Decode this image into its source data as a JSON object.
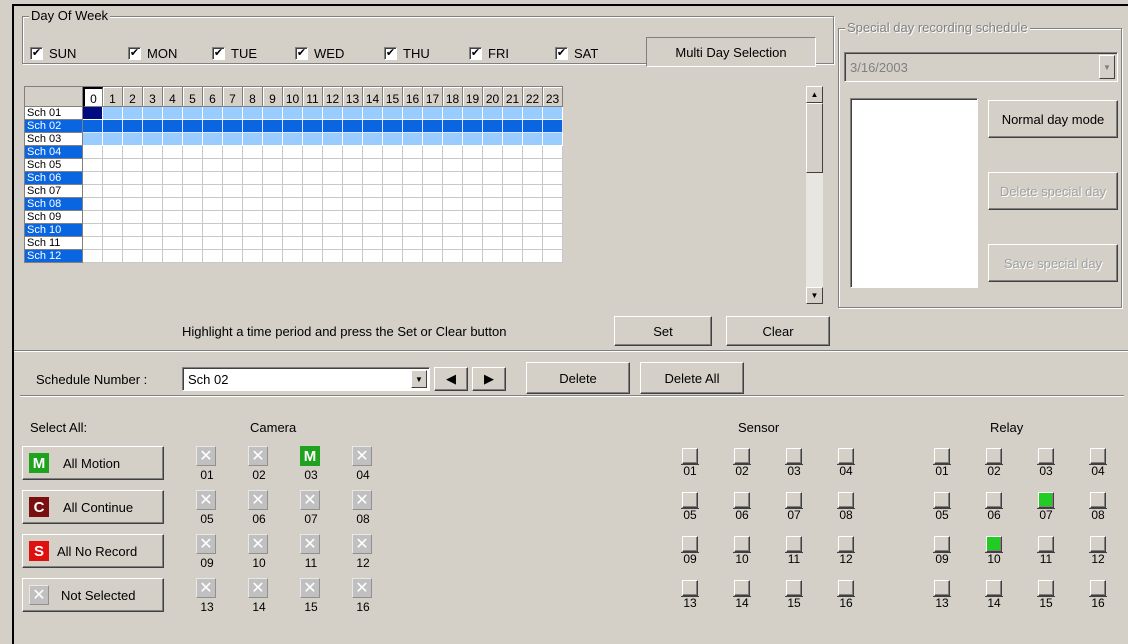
{
  "day_of_week": {
    "group_label": "Day Of Week",
    "days": [
      {
        "label": "SUN",
        "checked": true
      },
      {
        "label": "MON",
        "checked": true
      },
      {
        "label": "TUE",
        "checked": true
      },
      {
        "label": "WED",
        "checked": true
      },
      {
        "label": "THU",
        "checked": true
      },
      {
        "label": "FRI",
        "checked": true
      },
      {
        "label": "SAT",
        "checked": true
      }
    ],
    "multi_day_button": "Multi Day Selection"
  },
  "grid": {
    "hours": [
      "0",
      "1",
      "2",
      "3",
      "4",
      "5",
      "6",
      "7",
      "8",
      "9",
      "10",
      "11",
      "12",
      "13",
      "14",
      "15",
      "16",
      "17",
      "18",
      "19",
      "20",
      "21",
      "22",
      "23"
    ],
    "rows": [
      "Sch 01",
      "Sch 02",
      "Sch 03",
      "Sch 04",
      "Sch 05",
      "Sch 06",
      "Sch 07",
      "Sch 08",
      "Sch 09",
      "Sch 10",
      "Sch 11",
      "Sch 12"
    ],
    "hint": "Highlight a time period and press the Set or Clear button",
    "set_button": "Set",
    "clear_button": "Clear"
  },
  "special": {
    "group_label": "Special day recording schedule",
    "date_value": "3/16/2003",
    "normal_button": "Normal day mode",
    "delete_button": "Delete special day",
    "save_button": "Save special day"
  },
  "schedule": {
    "label": "Schedule Number :",
    "value": "Sch 02",
    "delete_button": "Delete",
    "delete_all_button": "Delete All"
  },
  "select_all": {
    "label": "Select All:",
    "motion_icon": "M",
    "motion_label": "All Motion",
    "continue_icon": "C",
    "continue_label": "All Continue",
    "norecord_icon": "S",
    "norecord_label": "All No Record",
    "notsel_icon": "✕",
    "notsel_label": "Not Selected"
  },
  "camera": {
    "label": "Camera",
    "items": [
      {
        "num": "01",
        "state": "x"
      },
      {
        "num": "02",
        "state": "x"
      },
      {
        "num": "03",
        "state": "m"
      },
      {
        "num": "04",
        "state": "x"
      },
      {
        "num": "05",
        "state": "x"
      },
      {
        "num": "06",
        "state": "x"
      },
      {
        "num": "07",
        "state": "x"
      },
      {
        "num": "08",
        "state": "x"
      },
      {
        "num": "09",
        "state": "x"
      },
      {
        "num": "10",
        "state": "x"
      },
      {
        "num": "11",
        "state": "x"
      },
      {
        "num": "12",
        "state": "x"
      },
      {
        "num": "13",
        "state": "x"
      },
      {
        "num": "14",
        "state": "x"
      },
      {
        "num": "15",
        "state": "x"
      },
      {
        "num": "16",
        "state": "x"
      }
    ]
  },
  "sensor": {
    "label": "Sensor",
    "items": [
      "01",
      "02",
      "03",
      "04",
      "05",
      "06",
      "07",
      "08",
      "09",
      "10",
      "11",
      "12",
      "13",
      "14",
      "15",
      "16"
    ]
  },
  "relay": {
    "label": "Relay",
    "items": [
      "01",
      "02",
      "03",
      "04",
      "05",
      "06",
      "07",
      "08",
      "09",
      "10",
      "11",
      "12",
      "13",
      "14",
      "15",
      "16"
    ],
    "on": [
      "07",
      "10"
    ]
  },
  "colors": {
    "motion": "#1fa31f",
    "continue": "#7a0f0f",
    "norecord": "#e01010",
    "selection": "#0a66e0",
    "highlight": "#99ccff"
  }
}
